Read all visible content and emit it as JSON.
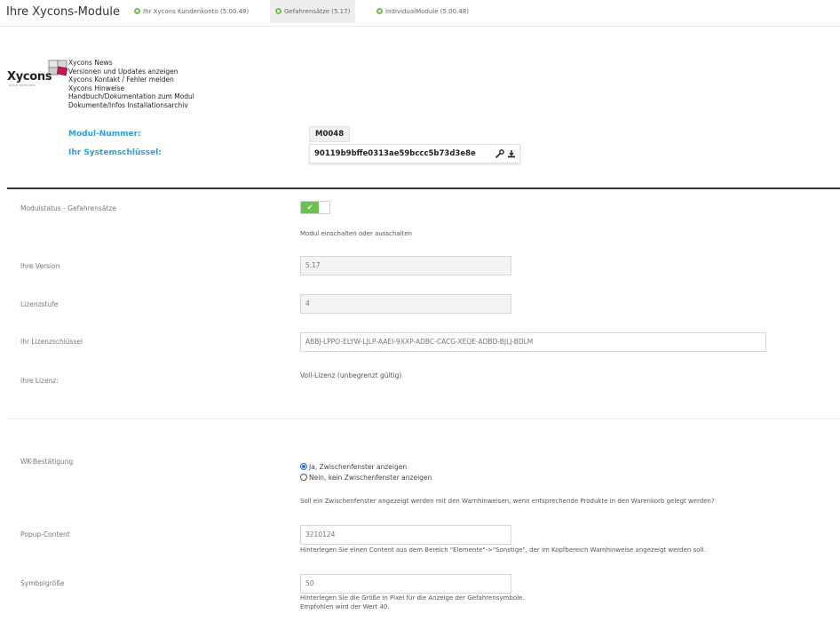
{
  "header": {
    "title": "Ihre Xycons-Module",
    "tabs": [
      {
        "label": "Ihr Xycons Kundenkonto (5.00.48)",
        "active": false
      },
      {
        "label": "Gefahrensätze (5.17)",
        "active": true
      },
      {
        "label": "IndividualModule (5.00.48)",
        "active": false
      }
    ]
  },
  "module_info": {
    "logo_text": "Xycons",
    "logo_subtext": "SHOP SERVICES",
    "links": [
      "Xycons News",
      "Versionen und Updates anzeigen",
      "Xycons Kontakt / Fehler melden",
      "Xycons Hinweise",
      "Handbuch/Dokumentation zum Modul",
      "Dokumente/Infos Installationsarchiv"
    ],
    "modul_nummer_label": "Modul-Nummer:",
    "modul_nummer_value": "M0048",
    "systemschluessel_label": "Ihr Systemschlüssel:",
    "systemschluessel_value": "90119b9bffe0313ae59bccc5b73d3e8e",
    "icons": [
      "wrench-icon",
      "download-icon"
    ]
  },
  "form": {
    "modulstatus": {
      "label": "Modulstatus - Gefahrensätze",
      "enabled": true,
      "toggle_glyph": "✔",
      "help": "Modul einschalten oder ausschalten"
    },
    "version": {
      "label": "Ihre Version",
      "value": "5.17"
    },
    "lizenzstufe": {
      "label": "Lizenzstufe",
      "value": "4"
    },
    "lizenzschluessel": {
      "label": "Ihr Lizenzschlüssel",
      "value": "ABBJ-LPPO-ELYW-LJLP-AAEI-9XXP-ADBC-CACG-XEQE-ADBD-BJLJ-BDLM"
    },
    "lizenz": {
      "label": "Ihre Lizenz:",
      "value": "Voll-Lizenz (unbegrenzt gültig)"
    },
    "wk_bestaetigung": {
      "label": "WK-Bestätigung",
      "options": [
        {
          "label": "Ja, Zwischenfenster anzeigen",
          "checked": true
        },
        {
          "label": "Nein, kein Zwischenfenster anzeigen",
          "checked": false
        }
      ],
      "help": "Soll ein Zwischenfenster angezeigt werden mit den Warnhinweisen, wenn entsprechende Produkte in den Warenkorb gelegt werden?"
    },
    "popup_content": {
      "label": "Popup-Content",
      "value": "3210124",
      "help": "Hinterlegen Sie einen Content aus dem Bereich \"Elemente\"->\"Sonstige\", der im Kopfbereich Warnhinweise angezeigt werden soll."
    },
    "symbolgroesse": {
      "label": "Symbolgröße",
      "value": "50",
      "help_line1": "Hinterlegen Sie die Größe in Pixel für die Anzeige der Gefahrensymbole.",
      "help_line2": "Empfohlen wird der Wert 40."
    }
  },
  "colors": {
    "accent_blue": "#2b9fdc",
    "toggle_green": "#6cc24a",
    "divider_dark": "#2e3338"
  }
}
